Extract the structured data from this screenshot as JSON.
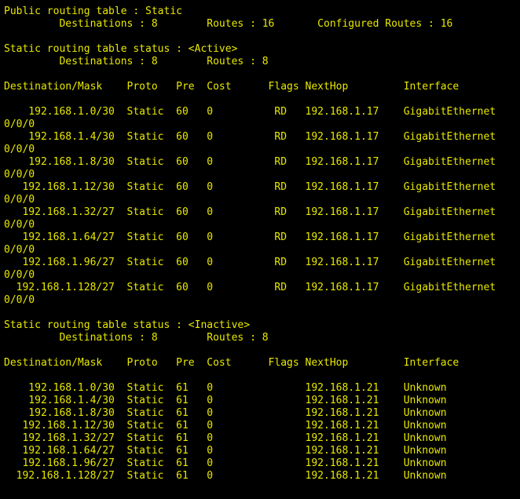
{
  "colors": {
    "background": "#000000",
    "text": "#e8e800"
  },
  "lines": [
    "Public routing table : Static",
    "         Destinations : 8        Routes : 16       Configured Routes : 16",
    "",
    "Static routing table status : <Active>",
    "         Destinations : 8        Routes : 8",
    "",
    "Destination/Mask    Proto   Pre  Cost      Flags NextHop         Interface",
    "",
    "    192.168.1.0/30  Static  60   0          RD   192.168.1.17    GigabitEthernet",
    "0/0/0",
    "    192.168.1.4/30  Static  60   0          RD   192.168.1.17    GigabitEthernet",
    "0/0/0",
    "    192.168.1.8/30  Static  60   0          RD   192.168.1.17    GigabitEthernet",
    "0/0/0",
    "   192.168.1.12/30  Static  60   0          RD   192.168.1.17    GigabitEthernet",
    "0/0/0",
    "   192.168.1.32/27  Static  60   0          RD   192.168.1.17    GigabitEthernet",
    "0/0/0",
    "   192.168.1.64/27  Static  60   0          RD   192.168.1.17    GigabitEthernet",
    "0/0/0",
    "   192.168.1.96/27  Static  60   0          RD   192.168.1.17    GigabitEthernet",
    "0/0/0",
    "  192.168.1.128/27  Static  60   0          RD   192.168.1.17    GigabitEthernet",
    "0/0/0",
    "",
    "Static routing table status : <Inactive>",
    "         Destinations : 8        Routes : 8",
    "",
    "Destination/Mask    Proto   Pre  Cost      Flags NextHop         Interface",
    "",
    "    192.168.1.0/30  Static  61   0               192.168.1.21    Unknown",
    "    192.168.1.4/30  Static  61   0               192.168.1.21    Unknown",
    "    192.168.1.8/30  Static  61   0               192.168.1.21    Unknown",
    "   192.168.1.12/30  Static  61   0               192.168.1.21    Unknown",
    "   192.168.1.32/27  Static  61   0               192.168.1.21    Unknown",
    "   192.168.1.64/27  Static  61   0               192.168.1.21    Unknown",
    "   192.168.1.96/27  Static  61   0               192.168.1.21    Unknown",
    "  192.168.1.128/27  Static  61   0               192.168.1.21    Unknown"
  ]
}
